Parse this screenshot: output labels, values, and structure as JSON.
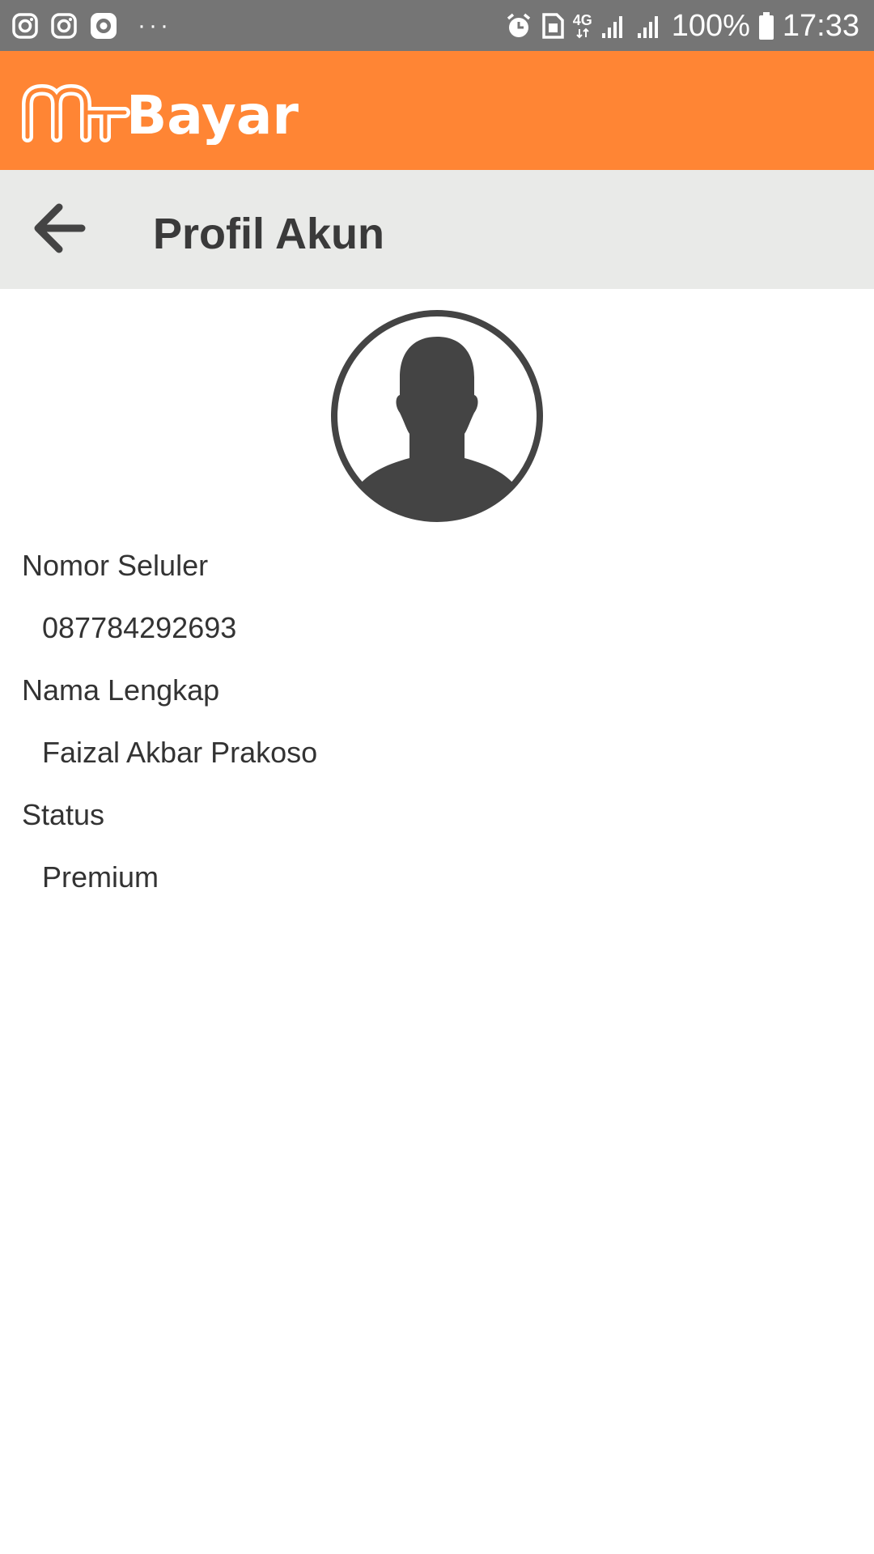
{
  "status_bar": {
    "left_icons": [
      "instagram-icon",
      "instagram-icon",
      "camera-app-icon",
      "more-notifications-icon"
    ],
    "more_dots": "···",
    "right_icons": [
      "alarm-icon",
      "sim-icon",
      "4g-icon",
      "signal-icon",
      "signal-icon"
    ],
    "network": "4G",
    "battery": "100%",
    "time": "17:33",
    "color": "#757575"
  },
  "brand": {
    "logo_text": "mBayar",
    "color": "#ff8534"
  },
  "header": {
    "back_icon": "arrow-left-icon",
    "title": "Profil Akun",
    "background": "#e9eae8"
  },
  "profile": {
    "avatar_icon": "user-avatar-icon",
    "fields": [
      {
        "label": "Nomor Seluler",
        "value": "087784292693"
      },
      {
        "label": "Nama Lengkap",
        "value": "Faizal Akbar Prakoso"
      },
      {
        "label": "Status",
        "value": "Premium"
      }
    ]
  }
}
